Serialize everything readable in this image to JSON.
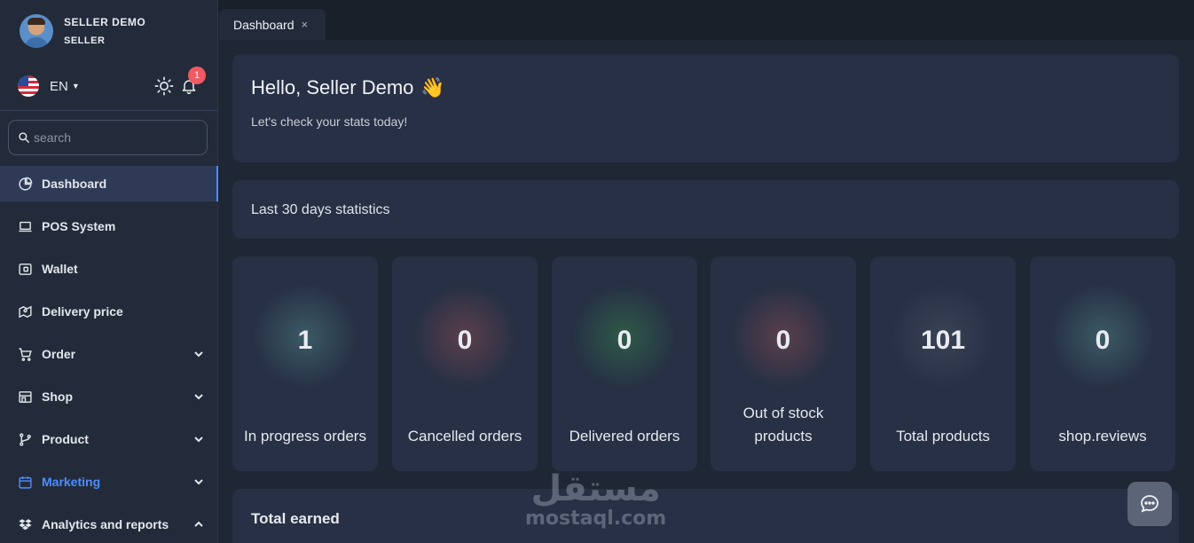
{
  "profile": {
    "name": "SELLER DEMO",
    "role": "SELLER"
  },
  "language": {
    "code": "EN"
  },
  "notifications": {
    "count": "1"
  },
  "search": {
    "placeholder": "search"
  },
  "sidebar": {
    "items": [
      {
        "label": "Dashboard",
        "icon": "pie-chart-icon",
        "active": true,
        "expandable": false
      },
      {
        "label": "POS System",
        "icon": "laptop-icon",
        "expandable": false
      },
      {
        "label": "Wallet",
        "icon": "wallet-icon",
        "expandable": false
      },
      {
        "label": "Delivery price",
        "icon": "map-pin-icon",
        "expandable": false
      },
      {
        "label": "Order",
        "icon": "cart-icon",
        "expandable": true
      },
      {
        "label": "Shop",
        "icon": "store-icon",
        "expandable": true
      },
      {
        "label": "Product",
        "icon": "branch-icon",
        "expandable": true
      },
      {
        "label": "Marketing",
        "icon": "calendar-icon",
        "expandable": true,
        "highlight": true
      },
      {
        "label": "Analytics and reports",
        "icon": "dropbox-icon",
        "expandable": true,
        "expanded": true
      }
    ]
  },
  "tabs": [
    {
      "label": "Dashboard",
      "close": "×"
    }
  ],
  "greeting": {
    "title": "Hello, Seller Demo",
    "emoji": "👋",
    "subtitle": "Let's check your stats today!"
  },
  "stats_header": {
    "label": "Last 30 days statistics"
  },
  "stats": [
    {
      "value": "1",
      "label": "In progress orders",
      "glow": "#3c5a66"
    },
    {
      "value": "0",
      "label": "Cancelled orders",
      "glow": "#5a3f4c"
    },
    {
      "value": "0",
      "label": "Delivered orders",
      "glow": "#2f5a48"
    },
    {
      "value": "0",
      "label": "Out of stock products",
      "glow": "#5a3f4c"
    },
    {
      "value": "101",
      "label": "Total products",
      "glow": "#3a4256"
    },
    {
      "value": "0",
      "label": "shop.reviews",
      "glow": "#3c5a66"
    }
  ],
  "earned": {
    "label": "Total earned"
  },
  "watermark": {
    "arabic": "مستقل",
    "latin": "mostaql.com"
  },
  "colors": {
    "accent": "#4c8dff",
    "badge": "#f05a63",
    "background": "#1f2634",
    "card": "#273044"
  }
}
